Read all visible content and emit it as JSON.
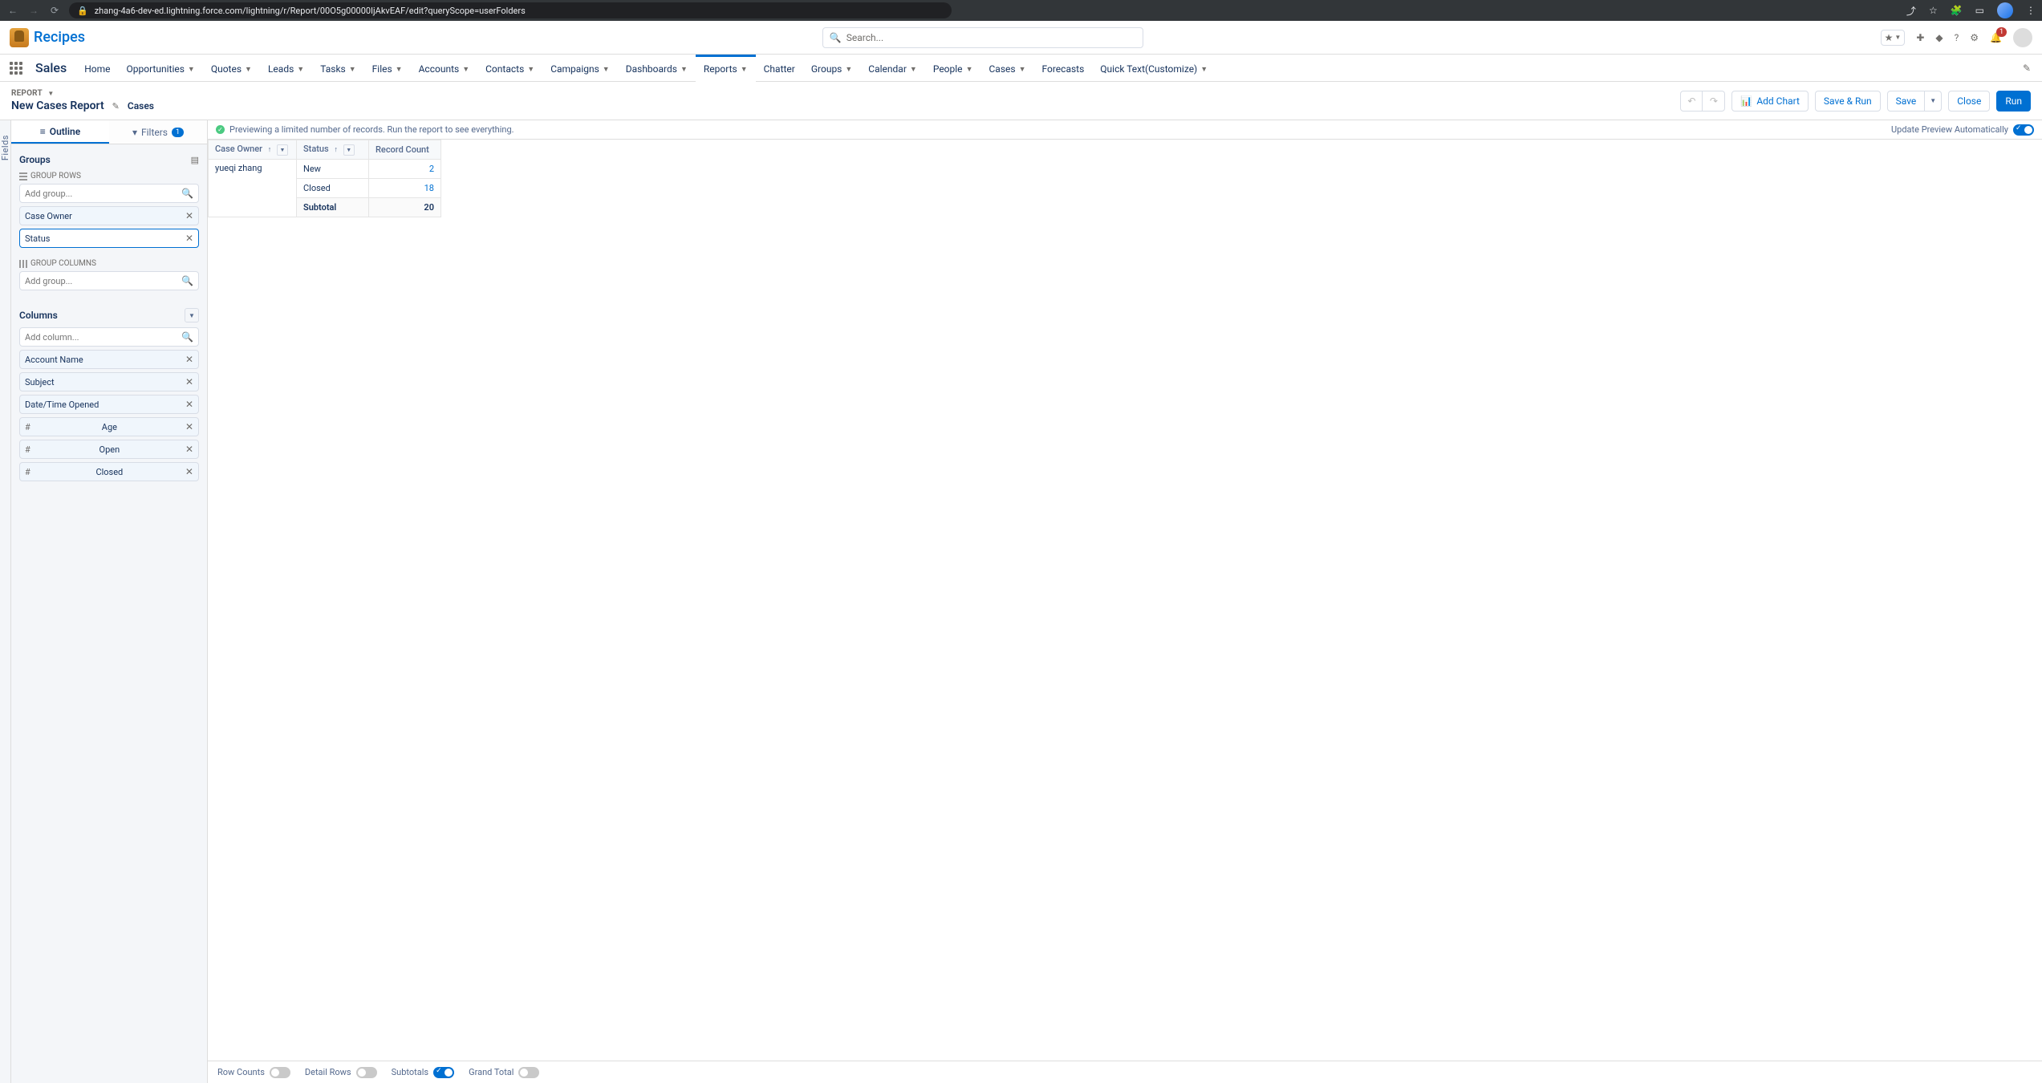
{
  "browser": {
    "url": "zhang-4a6-dev-ed.lightning.force.com/lightning/r/Report/00O5g00000IjAkvEAF/edit?queryScope=userFolders"
  },
  "brand": {
    "title": "Recipes"
  },
  "search": {
    "placeholder": "Search..."
  },
  "notif_badge": "1",
  "app_name": "Sales",
  "nav": [
    {
      "label": "Home",
      "dd": false
    },
    {
      "label": "Opportunities",
      "dd": true
    },
    {
      "label": "Quotes",
      "dd": true
    },
    {
      "label": "Leads",
      "dd": true
    },
    {
      "label": "Tasks",
      "dd": true
    },
    {
      "label": "Files",
      "dd": true
    },
    {
      "label": "Accounts",
      "dd": true
    },
    {
      "label": "Contacts",
      "dd": true
    },
    {
      "label": "Campaigns",
      "dd": true
    },
    {
      "label": "Dashboards",
      "dd": true
    },
    {
      "label": "Reports",
      "dd": true,
      "active": true
    },
    {
      "label": "Chatter",
      "dd": false
    },
    {
      "label": "Groups",
      "dd": true
    },
    {
      "label": "Calendar",
      "dd": true
    },
    {
      "label": "People",
      "dd": true
    },
    {
      "label": "Cases",
      "dd": true
    },
    {
      "label": "Forecasts",
      "dd": false
    },
    {
      "label": "Quick Text(Customize)",
      "dd": true
    }
  ],
  "page": {
    "breadcrumb": "REPORT",
    "title": "New Cases Report",
    "subtitle": "Cases"
  },
  "actions": {
    "add_chart": "Add Chart",
    "save_run": "Save & Run",
    "save": "Save",
    "close": "Close",
    "run": "Run"
  },
  "sidebar": {
    "tabs": {
      "outline": "Outline",
      "filters": "Filters",
      "filter_count": "1"
    },
    "groups_label": "Groups",
    "group_rows_label": "GROUP ROWS",
    "group_cols_label": "GROUP COLUMNS",
    "add_group_placeholder": "Add group...",
    "group_rows": [
      "Case Owner",
      "Status"
    ],
    "columns_label": "Columns",
    "add_column_placeholder": "Add column...",
    "columns": [
      {
        "label": "Account Name",
        "num": false
      },
      {
        "label": "Subject",
        "num": false
      },
      {
        "label": "Date/Time Opened",
        "num": false
      },
      {
        "label": "Age",
        "num": true
      },
      {
        "label": "Open",
        "num": true
      },
      {
        "label": "Closed",
        "num": true
      }
    ]
  },
  "preview": {
    "msg": "Previewing a limited number of records. Run the report to see everything.",
    "auto_label": "Update Preview Automatically",
    "headers": [
      "Case Owner",
      "Status",
      "Record Count"
    ],
    "owner": "yueqi zhang",
    "rows": [
      {
        "status": "New",
        "count": "2"
      },
      {
        "status": "Closed",
        "count": "18"
      }
    ],
    "subtotal_label": "Subtotal",
    "subtotal_count": "20"
  },
  "footer": {
    "row_counts": "Row Counts",
    "detail_rows": "Detail Rows",
    "subtotals": "Subtotals",
    "grand_total": "Grand Total"
  },
  "fields_rail": "Fields"
}
